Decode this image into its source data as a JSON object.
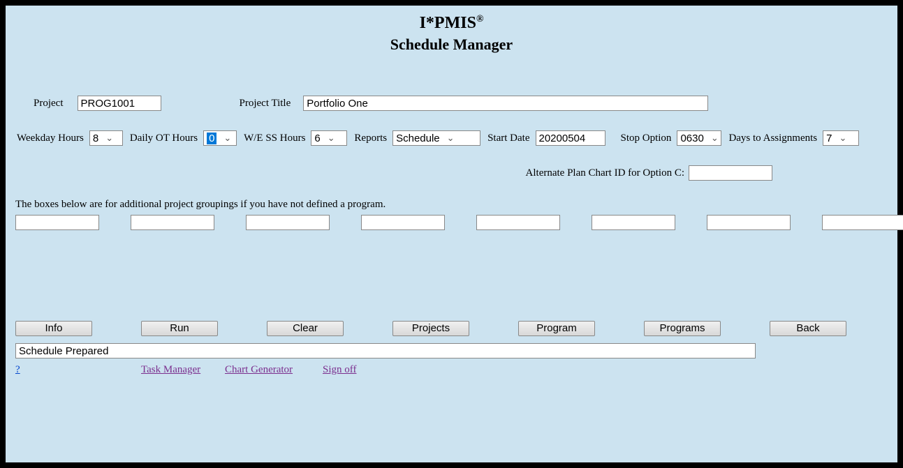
{
  "header": {
    "title_text": "I*PMIS",
    "title_sup": "®",
    "subtitle": "Schedule Manager"
  },
  "project": {
    "label": "Project",
    "code": "PROG1001",
    "title_label": "Project Title",
    "title_value": "Portfolio One"
  },
  "options": {
    "weekday_hours_label": "Weekday Hours",
    "weekday_hours_value": "8",
    "daily_ot_label": "Daily OT Hours",
    "daily_ot_value": "0",
    "we_ss_label": "W/E SS Hours",
    "we_ss_value": "6",
    "reports_label": "Reports",
    "reports_value": "Schedule",
    "start_date_label": "Start Date",
    "start_date_value": "20200504",
    "stop_option_label": "Stop Option",
    "stop_option_value": "0630",
    "days_assign_label": "Days to Assignments",
    "days_assign_value": "7"
  },
  "alt_chart": {
    "label": "Alternate Plan Chart ID for Option C:",
    "value": ""
  },
  "groupings": {
    "instruction": "The boxes below are for additional project groupings if you have not defined a program.",
    "values": [
      "",
      "",
      "",
      "",
      "",
      "",
      "",
      "",
      ""
    ]
  },
  "buttons": {
    "info": "Info",
    "run": "Run",
    "clear": "Clear",
    "projects": "Projects",
    "program": "Program",
    "programs": "Programs",
    "back": "Back"
  },
  "status": {
    "value": "Schedule Prepared"
  },
  "links": {
    "help": "?",
    "task_manager": "Task Manager",
    "chart_generator": "Chart Generator",
    "sign_off": "Sign off"
  }
}
